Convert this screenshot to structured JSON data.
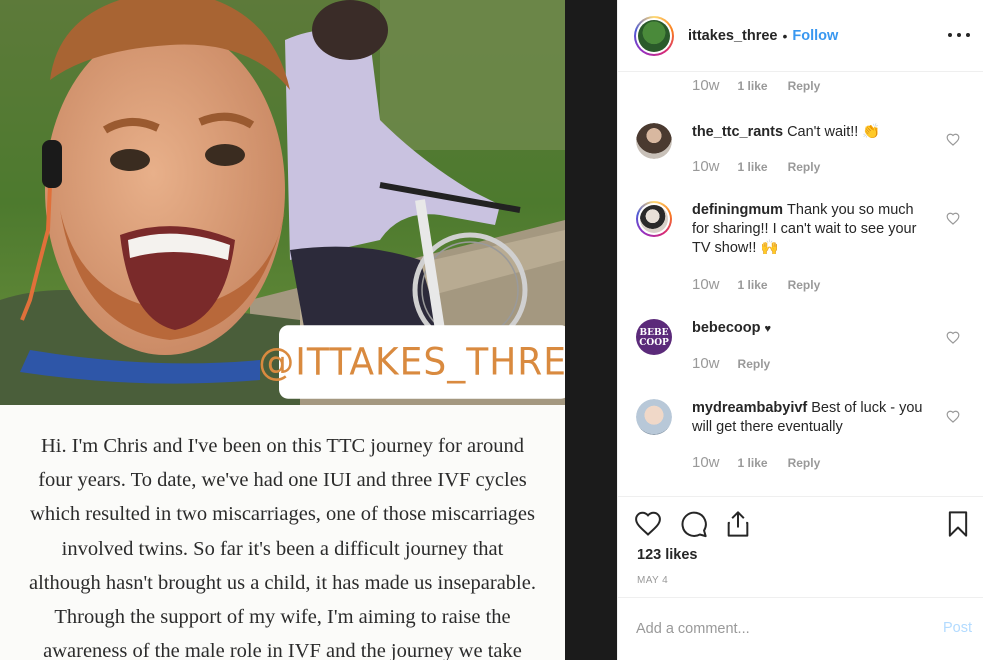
{
  "post": {
    "owner_username": "ittakes_three",
    "separator": "•",
    "follow_label": "Follow",
    "sticker_text": "@ITTAKES_THREE",
    "caption_lines": [
      "Hi.  I'm Chris and I've been on this TTC journey for around",
      "four years. To date, we've had one IUI and three IVF cycles",
      "which resulted in two miscarriages, one of those miscarriages",
      "involved twins. So far it's been a difficult journey that",
      "although hasn't brought us a child, it has made us inseparable.",
      "Through the support of my wife, I'm aiming to raise the",
      "awareness of the male role in IVF and the journey we take"
    ],
    "likes": "123 likes",
    "date": "MAY 4"
  },
  "comments": [
    {
      "username": "",
      "text": "",
      "time": "10w",
      "likes": "1 like",
      "reply": "Reply"
    },
    {
      "username": "the_ttc_rants",
      "text": "Can't wait!! 👏",
      "time": "10w",
      "likes": "1 like",
      "reply": "Reply"
    },
    {
      "username": "definingmum",
      "text": "Thank you so much for sharing!! I can't wait to see your TV show!! 🙌",
      "time": "10w",
      "likes": "1 like",
      "reply": "Reply"
    },
    {
      "username": "bebecoop",
      "text": "♥",
      "time": "10w",
      "likes": "",
      "reply": "Reply"
    },
    {
      "username": "mydreambabyivf",
      "text": "Best of luck - you will get there eventually",
      "time": "10w",
      "likes": "1 like",
      "reply": "Reply"
    }
  ],
  "avatars": {
    "bebecoop_text_1": "BEBE",
    "bebecoop_text_2": "COOP"
  },
  "comment_form": {
    "placeholder": "Add a comment...",
    "post_label": "Post"
  },
  "icons": {
    "more": "more-options-icon",
    "like": "heart-icon",
    "comment": "comment-bubble-icon",
    "share": "share-icon",
    "save": "bookmark-icon"
  },
  "colors": {
    "accent": "#3897f0",
    "muted": "#999999",
    "post_disabled": "#b3dbff",
    "sticker_text": "#d98a3f"
  }
}
